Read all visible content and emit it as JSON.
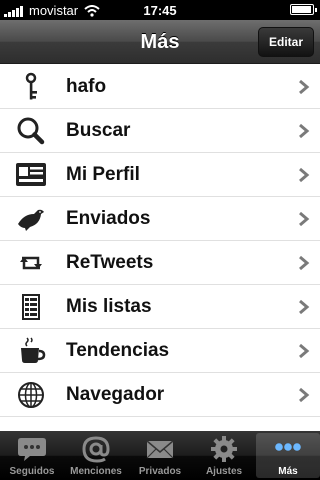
{
  "status_bar": {
    "carrier": "movistar",
    "time": "17:45",
    "battery_level": 0.95
  },
  "nav_bar": {
    "title": "Más",
    "edit_label": "Editar"
  },
  "menu": {
    "items": [
      {
        "label": "hafo",
        "icon": "key-icon"
      },
      {
        "label": "Buscar",
        "icon": "search-icon"
      },
      {
        "label": "Mi Perfil",
        "icon": "profile-card-icon"
      },
      {
        "label": "Enviados",
        "icon": "bird-icon"
      },
      {
        "label": "ReTweets",
        "icon": "retweet-icon"
      },
      {
        "label": "Mis listas",
        "icon": "lists-icon"
      },
      {
        "label": "Tendencias",
        "icon": "coffee-cup-icon"
      },
      {
        "label": "Navegador",
        "icon": "globe-icon"
      }
    ]
  },
  "tab_bar": {
    "tabs": [
      {
        "label": "Seguidos",
        "icon": "speech-bubble-icon"
      },
      {
        "label": "Menciones",
        "icon": "at-icon"
      },
      {
        "label": "Privados",
        "icon": "envelope-icon"
      },
      {
        "label": "Ajustes",
        "icon": "gear-icon"
      },
      {
        "label": "Más",
        "icon": "more-dots-icon"
      }
    ],
    "active_tab": "Más"
  }
}
